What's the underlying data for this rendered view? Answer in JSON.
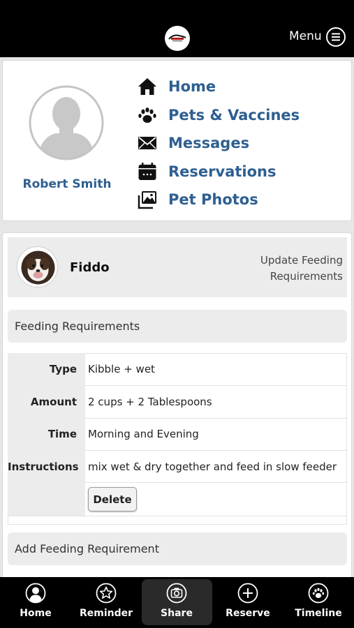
{
  "header": {
    "menu_label": "Menu"
  },
  "profile": {
    "name": "Robert Smith",
    "nav": [
      {
        "label": "Home",
        "icon": "home-icon"
      },
      {
        "label": "Pets & Vaccines",
        "icon": "paw-icon"
      },
      {
        "label": "Messages",
        "icon": "envelope-icon"
      },
      {
        "label": "Reservations",
        "icon": "calendar-icon"
      },
      {
        "label": "Pet Photos",
        "icon": "photos-icon"
      }
    ]
  },
  "pet": {
    "name": "Fiddo",
    "update_link": "Update Feeding Requirements"
  },
  "feeding": {
    "section_title": "Feeding Requirements",
    "rows": [
      {
        "label": "Type",
        "value": "Kibble + wet"
      },
      {
        "label": "Amount",
        "value": "2 cups + 2 Tablespoons"
      },
      {
        "label": "Time",
        "value": "Morning and Evening"
      },
      {
        "label": "Instructions",
        "value": "mix wet & dry together and feed in slow feeder"
      }
    ],
    "delete_label": "Delete",
    "add_label": "Add Feeding Requirement"
  },
  "bottom_nav": [
    {
      "label": "Home",
      "icon": "user-circle-icon"
    },
    {
      "label": "Reminder",
      "icon": "star-icon"
    },
    {
      "label": "Share",
      "icon": "camera-icon",
      "active": true
    },
    {
      "label": "Reserve",
      "icon": "plus-circle-icon"
    },
    {
      "label": "Timeline",
      "icon": "paw-circle-icon"
    }
  ],
  "colors": {
    "link": "#2e5f91",
    "topbar": "#000000",
    "panel": "#ececec"
  }
}
